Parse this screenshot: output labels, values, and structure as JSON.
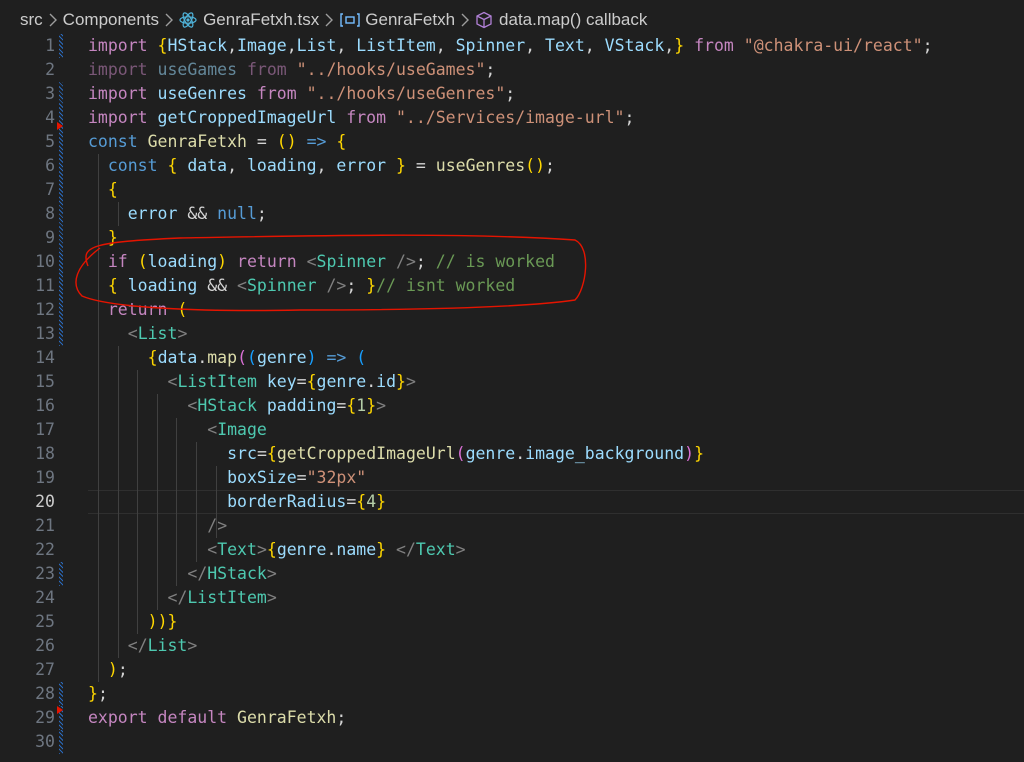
{
  "breadcrumb": {
    "items": [
      "src",
      "Components",
      "GenraFetxh.tsx",
      "GenraFetxh",
      "data.map() callback"
    ],
    "icons": [
      "chevron-right-icon",
      "react-icon",
      "component-icon",
      "method-cube-icon"
    ]
  },
  "editor": {
    "active_line": 20,
    "line_numbers": [
      "1",
      "2",
      "3",
      "4",
      "5",
      "6",
      "7",
      "8",
      "9",
      "10",
      "11",
      "12",
      "13",
      "14",
      "15",
      "16",
      "17",
      "18",
      "19",
      "20",
      "21",
      "22",
      "23",
      "24",
      "25",
      "26",
      "27",
      "28",
      "29",
      "30"
    ],
    "colors": {
      "background": "#1f1f1f",
      "annotation": "#e51400",
      "keyword": "#c586c0",
      "string": "#ce9178",
      "comment": "#6a9955",
      "component": "#4ec9b0"
    },
    "lines": [
      "import {HStack,Image,List, ListItem, Spinner, Text, VStack,} from \"@chakra-ui/react\";",
      "import useGames from \"../hooks/useGames\";",
      "import useGenres from \"../hooks/useGenres\";",
      "import getCroppedImageUrl from \"../Services/image-url\";",
      "const GenraFetxh = () => {",
      "  const { data, loading, error } = useGenres();",
      "  {",
      "    error && null;",
      "  }",
      "  if (loading) return <Spinner />; // is worked",
      "  { loading && <Spinner />; }// isnt worked",
      "  return (",
      "    <List>",
      "      {data.map((genre) => (",
      "        <ListItem key={genre.id}>",
      "          <HStack padding={1}>",
      "            <Image",
      "              src={getCroppedImageUrl(genre.image_background)}",
      "              boxSize=\"32px\"",
      "              borderRadius={4}",
      "            />",
      "            <Text>{genre.name} </Text>",
      "          </HStack>",
      "        </ListItem>",
      "      ))}",
      "    </List>",
      "  );",
      "};",
      "export default GenraFetxh;",
      ""
    ]
  }
}
